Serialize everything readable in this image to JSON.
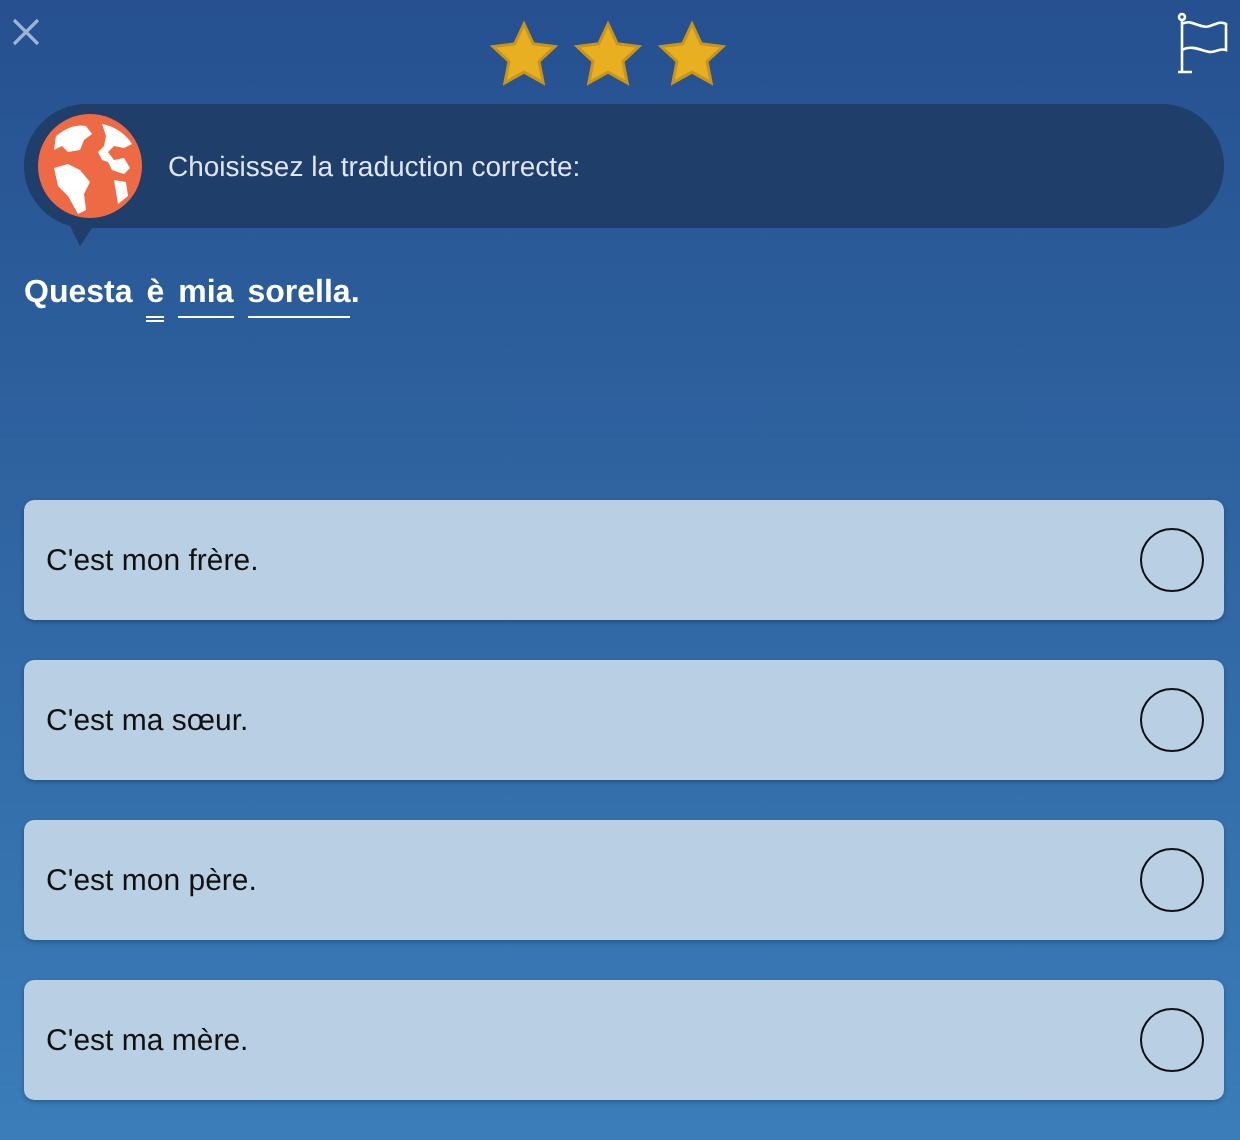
{
  "header": {
    "stars": 3
  },
  "prompt": {
    "text": "Choisissez la traduction correcte:"
  },
  "sentence": [
    {
      "text": "Questa",
      "kind": "word"
    },
    {
      "text": "è",
      "kind": "hint-double"
    },
    {
      "text": "mia",
      "kind": "hint-single"
    },
    {
      "text": "sorella",
      "kind": "hint-single"
    },
    {
      "text": ".",
      "kind": "punct"
    }
  ],
  "options": [
    {
      "text": "C'est mon frère.",
      "selected": false
    },
    {
      "text": "C'est ma sœur.",
      "selected": false
    },
    {
      "text": "C'est mon père.",
      "selected": false
    },
    {
      "text": "C'est ma mère.",
      "selected": false
    }
  ]
}
